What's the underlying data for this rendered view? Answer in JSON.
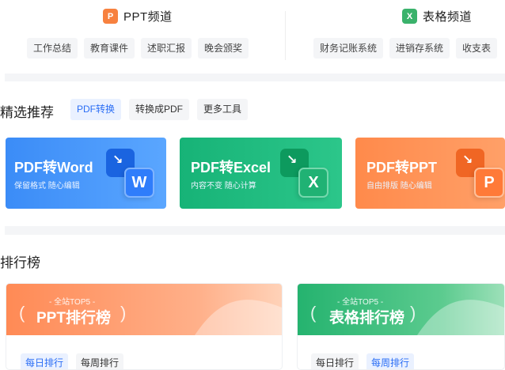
{
  "channels": {
    "ppt": {
      "logo_letter": "P",
      "title": "PPT频道",
      "tags": [
        "工作总结",
        "教育课件",
        "述职汇报",
        "晚会颁奖"
      ]
    },
    "excel": {
      "logo_letter": "X",
      "title": "表格频道",
      "tags": [
        "财务记账系统",
        "进销存系统",
        "收支表"
      ]
    }
  },
  "featured": {
    "title": "精选推荐",
    "tabs": [
      "PDF转换",
      "转换成PDF",
      "更多工具"
    ],
    "active_tab": "PDF转换",
    "cards": [
      {
        "title": "PDF转Word",
        "subtitle": "保留格式 随心编辑",
        "icon_letter": "W",
        "icon": "pdf-to-word-icon"
      },
      {
        "title": "PDF转Excel",
        "subtitle": "内容不变 随心计算",
        "icon_letter": "X",
        "icon": "pdf-to-excel-icon"
      },
      {
        "title": "PDF转PPT",
        "subtitle": "自由排版 随心编辑",
        "icon_letter": "P",
        "icon": "pdf-to-ppt-icon"
      }
    ]
  },
  "ranking": {
    "title": "排行榜",
    "boards": [
      {
        "top_label": "- 全站TOP5 -",
        "title": "PPT排行榜",
        "tabs": [
          "每日排行",
          "每周排行"
        ],
        "active_tab": "每日排行"
      },
      {
        "top_label": "- 全站TOP5 -",
        "title": "表格排行榜",
        "tabs": [
          "每日排行",
          "每周排行"
        ],
        "active_tab": "每周排行"
      }
    ]
  },
  "colors": {
    "accent_blue": "#2b6ef5",
    "ppt_orange": "#f7813f",
    "excel_green": "#3ab26b",
    "word_blue": "#3b8cf7"
  }
}
